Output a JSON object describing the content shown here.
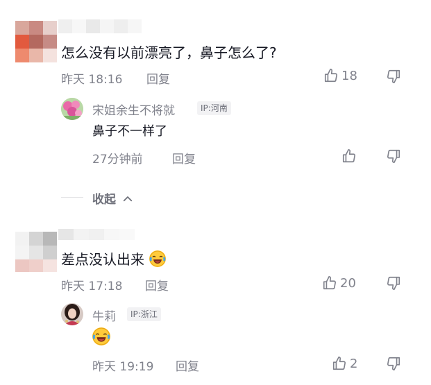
{
  "comments": [
    {
      "text": "怎么没有以前漂亮了，鼻子怎么了?",
      "time": "昨天 18:16",
      "reply_label": "回复",
      "likes": "18",
      "replies": [
        {
          "username": "宋姐余生不将就",
          "ip": "IP:河南",
          "text": "鼻子不一样了",
          "time": "27分钟前",
          "reply_label": "回复",
          "likes": ""
        }
      ],
      "collapse_label": "收起"
    },
    {
      "text": "差点没认出来",
      "time": "昨天 17:18",
      "reply_label": "回复",
      "likes": "20",
      "replies": [
        {
          "username": "牛莉",
          "ip": "IP:浙江",
          "text": "",
          "time": "昨天 19:19",
          "reply_label": "回复",
          "likes": "2"
        }
      ]
    }
  ],
  "icons": {
    "like": "thumbs-up-icon",
    "dislike": "thumbs-down-icon",
    "collapse": "chevron-up-icon",
    "emoji": "laughing-crying-emoji"
  },
  "colors": {
    "text_primary": "#161823",
    "text_secondary": "#80828c",
    "ip_badge_bg": "#f2f2f4"
  }
}
